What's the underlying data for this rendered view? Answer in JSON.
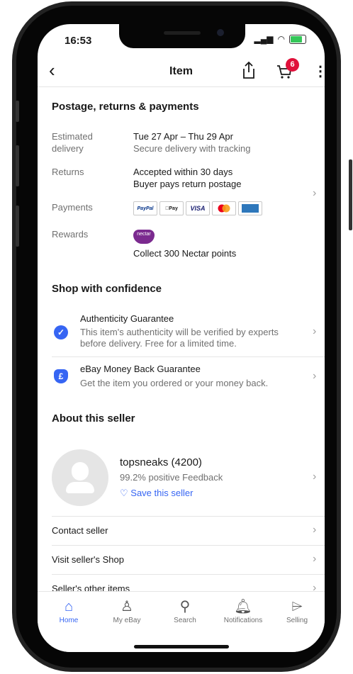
{
  "status": {
    "time": "16:53"
  },
  "header": {
    "title": "Item",
    "back_icon": "chevron-left-icon",
    "share_icon": "share-icon",
    "cart_icon": "cart-icon",
    "cart_badge": "6",
    "more_icon": "more-vertical-icon"
  },
  "postage": {
    "heading": "Postage, returns & payments",
    "delivery_label": "Estimated delivery",
    "delivery_date": "Tue 27 Apr – Thu 29 Apr",
    "delivery_note": "Secure delivery with tracking",
    "returns_label": "Returns",
    "returns_line1": "Accepted within 30 days",
    "returns_line2": "Buyer pays return postage",
    "payments_label": "Payments",
    "payment_methods": [
      "PayPal",
      "Pay",
      "VISA",
      "MC",
      "AMEX"
    ],
    "rewards_label": "Rewards",
    "nectar_logo": "nectar",
    "rewards_text": "Collect 300 Nectar points"
  },
  "confidence": {
    "heading": "Shop with confidence",
    "items": [
      {
        "title": "Authenticity Guarantee",
        "line1": "This item's authenticity will be verified by experts",
        "line2": "before delivery. Free for a limited time."
      },
      {
        "title": "eBay Money Back Guarantee",
        "line1": "Get the item you ordered or your money back."
      }
    ]
  },
  "seller": {
    "heading": "About this seller",
    "name": "topsneaks (4200)",
    "feedback": "99.2% positive Feedback",
    "save": "Save this seller",
    "links": [
      "Contact seller",
      "Visit seller's Shop",
      "Seller's other items"
    ]
  },
  "tabs": [
    {
      "label": "Home",
      "icon": "home-icon",
      "active": true
    },
    {
      "label": "My eBay",
      "icon": "user-icon"
    },
    {
      "label": "Search",
      "icon": "search-icon"
    },
    {
      "label": "Notifications",
      "icon": "bell-icon"
    },
    {
      "label": "Selling",
      "icon": "tag-icon"
    }
  ],
  "colors": {
    "accent": "#3665f3",
    "badge": "#e0103a"
  }
}
